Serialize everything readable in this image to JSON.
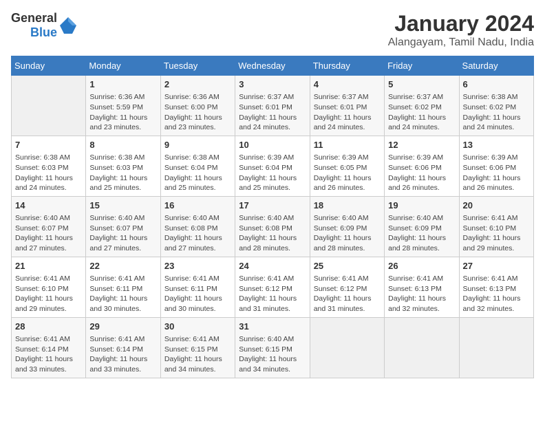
{
  "header": {
    "logo_general": "General",
    "logo_blue": "Blue",
    "title": "January 2024",
    "subtitle": "Alangayam, Tamil Nadu, India"
  },
  "days_of_week": [
    "Sunday",
    "Monday",
    "Tuesday",
    "Wednesday",
    "Thursday",
    "Friday",
    "Saturday"
  ],
  "weeks": [
    [
      {
        "num": "",
        "info": ""
      },
      {
        "num": "1",
        "info": "Sunrise: 6:36 AM\nSunset: 5:59 PM\nDaylight: 11 hours\nand 23 minutes."
      },
      {
        "num": "2",
        "info": "Sunrise: 6:36 AM\nSunset: 6:00 PM\nDaylight: 11 hours\nand 23 minutes."
      },
      {
        "num": "3",
        "info": "Sunrise: 6:37 AM\nSunset: 6:01 PM\nDaylight: 11 hours\nand 24 minutes."
      },
      {
        "num": "4",
        "info": "Sunrise: 6:37 AM\nSunset: 6:01 PM\nDaylight: 11 hours\nand 24 minutes."
      },
      {
        "num": "5",
        "info": "Sunrise: 6:37 AM\nSunset: 6:02 PM\nDaylight: 11 hours\nand 24 minutes."
      },
      {
        "num": "6",
        "info": "Sunrise: 6:38 AM\nSunset: 6:02 PM\nDaylight: 11 hours\nand 24 minutes."
      }
    ],
    [
      {
        "num": "7",
        "info": "Sunrise: 6:38 AM\nSunset: 6:03 PM\nDaylight: 11 hours\nand 24 minutes."
      },
      {
        "num": "8",
        "info": "Sunrise: 6:38 AM\nSunset: 6:03 PM\nDaylight: 11 hours\nand 25 minutes."
      },
      {
        "num": "9",
        "info": "Sunrise: 6:38 AM\nSunset: 6:04 PM\nDaylight: 11 hours\nand 25 minutes."
      },
      {
        "num": "10",
        "info": "Sunrise: 6:39 AM\nSunset: 6:04 PM\nDaylight: 11 hours\nand 25 minutes."
      },
      {
        "num": "11",
        "info": "Sunrise: 6:39 AM\nSunset: 6:05 PM\nDaylight: 11 hours\nand 26 minutes."
      },
      {
        "num": "12",
        "info": "Sunrise: 6:39 AM\nSunset: 6:06 PM\nDaylight: 11 hours\nand 26 minutes."
      },
      {
        "num": "13",
        "info": "Sunrise: 6:39 AM\nSunset: 6:06 PM\nDaylight: 11 hours\nand 26 minutes."
      }
    ],
    [
      {
        "num": "14",
        "info": "Sunrise: 6:40 AM\nSunset: 6:07 PM\nDaylight: 11 hours\nand 27 minutes."
      },
      {
        "num": "15",
        "info": "Sunrise: 6:40 AM\nSunset: 6:07 PM\nDaylight: 11 hours\nand 27 minutes."
      },
      {
        "num": "16",
        "info": "Sunrise: 6:40 AM\nSunset: 6:08 PM\nDaylight: 11 hours\nand 27 minutes."
      },
      {
        "num": "17",
        "info": "Sunrise: 6:40 AM\nSunset: 6:08 PM\nDaylight: 11 hours\nand 28 minutes."
      },
      {
        "num": "18",
        "info": "Sunrise: 6:40 AM\nSunset: 6:09 PM\nDaylight: 11 hours\nand 28 minutes."
      },
      {
        "num": "19",
        "info": "Sunrise: 6:40 AM\nSunset: 6:09 PM\nDaylight: 11 hours\nand 28 minutes."
      },
      {
        "num": "20",
        "info": "Sunrise: 6:41 AM\nSunset: 6:10 PM\nDaylight: 11 hours\nand 29 minutes."
      }
    ],
    [
      {
        "num": "21",
        "info": "Sunrise: 6:41 AM\nSunset: 6:10 PM\nDaylight: 11 hours\nand 29 minutes."
      },
      {
        "num": "22",
        "info": "Sunrise: 6:41 AM\nSunset: 6:11 PM\nDaylight: 11 hours\nand 30 minutes."
      },
      {
        "num": "23",
        "info": "Sunrise: 6:41 AM\nSunset: 6:11 PM\nDaylight: 11 hours\nand 30 minutes."
      },
      {
        "num": "24",
        "info": "Sunrise: 6:41 AM\nSunset: 6:12 PM\nDaylight: 11 hours\nand 31 minutes."
      },
      {
        "num": "25",
        "info": "Sunrise: 6:41 AM\nSunset: 6:12 PM\nDaylight: 11 hours\nand 31 minutes."
      },
      {
        "num": "26",
        "info": "Sunrise: 6:41 AM\nSunset: 6:13 PM\nDaylight: 11 hours\nand 32 minutes."
      },
      {
        "num": "27",
        "info": "Sunrise: 6:41 AM\nSunset: 6:13 PM\nDaylight: 11 hours\nand 32 minutes."
      }
    ],
    [
      {
        "num": "28",
        "info": "Sunrise: 6:41 AM\nSunset: 6:14 PM\nDaylight: 11 hours\nand 33 minutes."
      },
      {
        "num": "29",
        "info": "Sunrise: 6:41 AM\nSunset: 6:14 PM\nDaylight: 11 hours\nand 33 minutes."
      },
      {
        "num": "30",
        "info": "Sunrise: 6:41 AM\nSunset: 6:15 PM\nDaylight: 11 hours\nand 34 minutes."
      },
      {
        "num": "31",
        "info": "Sunrise: 6:40 AM\nSunset: 6:15 PM\nDaylight: 11 hours\nand 34 minutes."
      },
      {
        "num": "",
        "info": ""
      },
      {
        "num": "",
        "info": ""
      },
      {
        "num": "",
        "info": ""
      }
    ]
  ]
}
